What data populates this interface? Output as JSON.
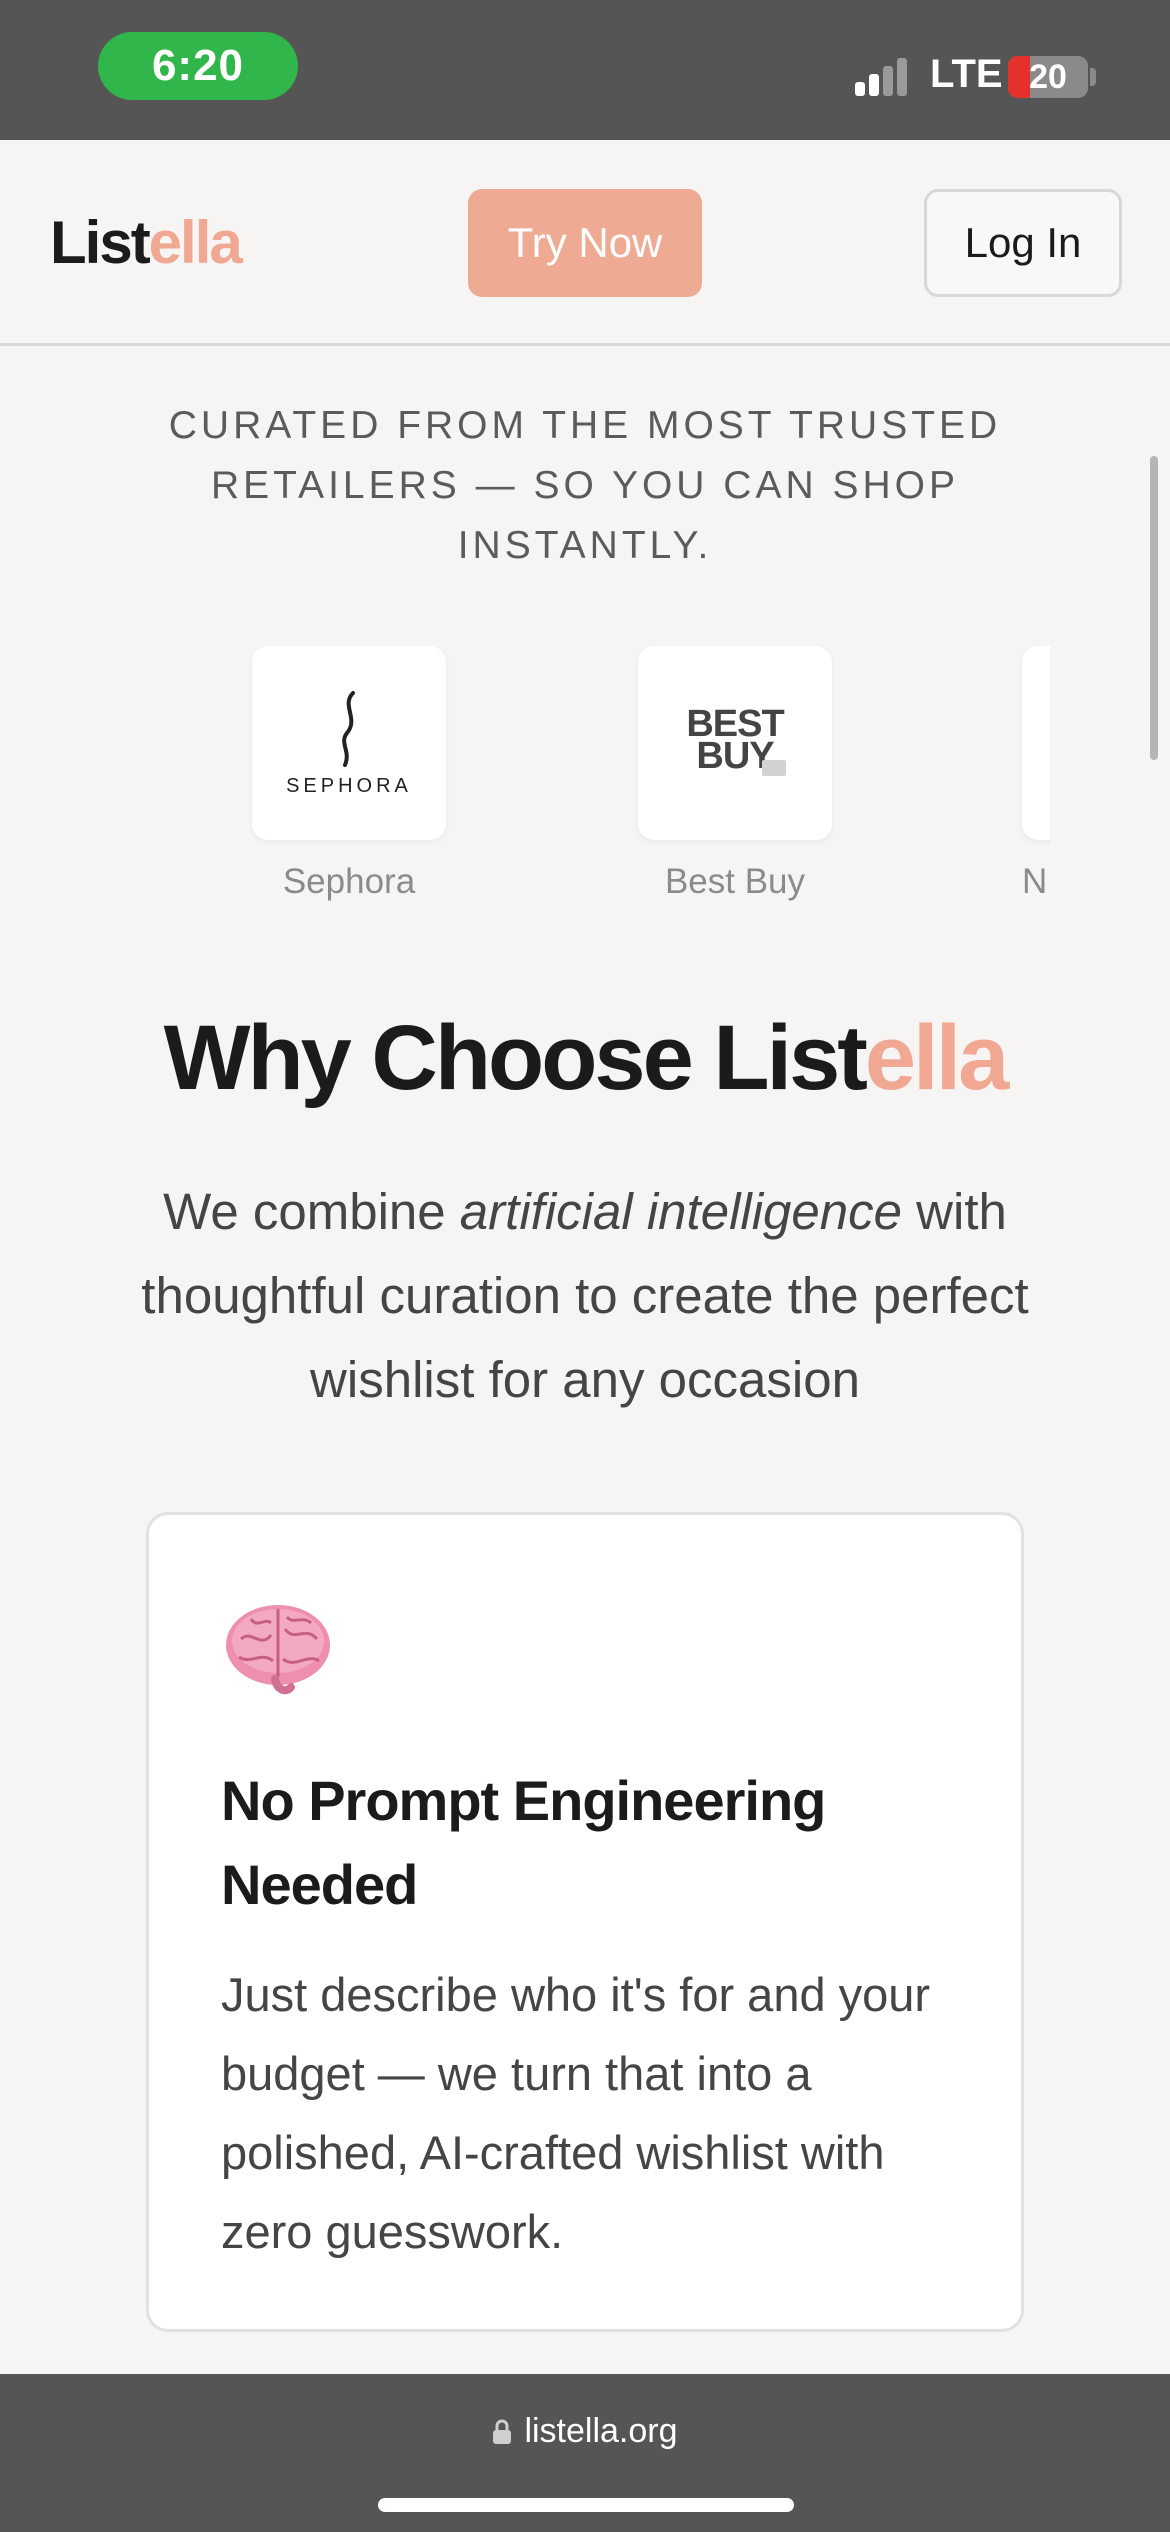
{
  "status_bar": {
    "time": "6:20",
    "carrier": "LTE",
    "battery": "20"
  },
  "header": {
    "logo_part1": "List",
    "logo_part2": "ella",
    "try_now": "Try Now",
    "log_in": "Log In"
  },
  "curated": {
    "text": "CURATED FROM THE MOST TRUSTED RETAILERS — SO YOU CAN SHOP INSTANTLY."
  },
  "retailers": [
    {
      "name": "Sephora",
      "logo_text": "SEPHORA",
      "icon": "sephora-logo"
    },
    {
      "name": "Best Buy",
      "logo_text": "BEST BUY",
      "icon": "bestbuy-logo"
    },
    {
      "name": "N",
      "icon": "retailer-logo"
    }
  ],
  "why": {
    "title_part1": "Why Choose List",
    "title_part2": "ella",
    "desc_part1": "We combine ",
    "desc_em": "artificial intelligence",
    "desc_part2": " with thoughtful curation to create the perfect wishlist for any occasion"
  },
  "feature": {
    "icon": "brain-icon",
    "title": "No Prompt Engineering Needed",
    "description": "Just describe who it's for and your budget — we turn that into a polished, AI-crafted wishlist with zero guesswork."
  },
  "browser": {
    "url": "listella.org"
  },
  "colors": {
    "accent": "#efaa94",
    "accent_text": "#f0a892",
    "background": "#f7f5f4",
    "status_bg": "#555555",
    "time_pill": "#30b64a"
  }
}
